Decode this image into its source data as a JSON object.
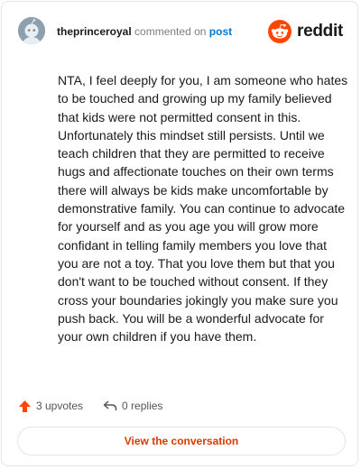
{
  "comment": {
    "username": "theprinceroyal",
    "action_text": "commented on",
    "target_link": "post",
    "body": "NTA, I feel deeply for you, I am someone who hates to be touched and growing up my family believed that kids were not permitted consent in this. Unfortunately this mindset still persists. Until we teach children that they are permitted to receive hugs and affectionate touches on their own terms there will always be kids make uncomfortable by demonstrative family. You can continue to advocate for yourself and as you age you will grow more confidant in telling family members you love that you are not a toy. That you love them but that you don't want to be touched without consent. If they cross your boundaries jokingly you make sure you push back. You will be a wonderful advocate for your own children if you have them.",
    "upvotes": "3 upvotes",
    "replies": "0 replies"
  },
  "brand": {
    "wordmark": "reddit",
    "icon": "reddit-snoo-icon",
    "accent": "#ff4500"
  },
  "footer": {
    "button_label": "View the conversation"
  },
  "colors": {
    "username": "#1a1a1b",
    "muted": "#7c7c7c",
    "link": "#0079d3",
    "upvote": "#ff4500",
    "button_text": "#d93a00",
    "border": "#e2e5e8"
  }
}
